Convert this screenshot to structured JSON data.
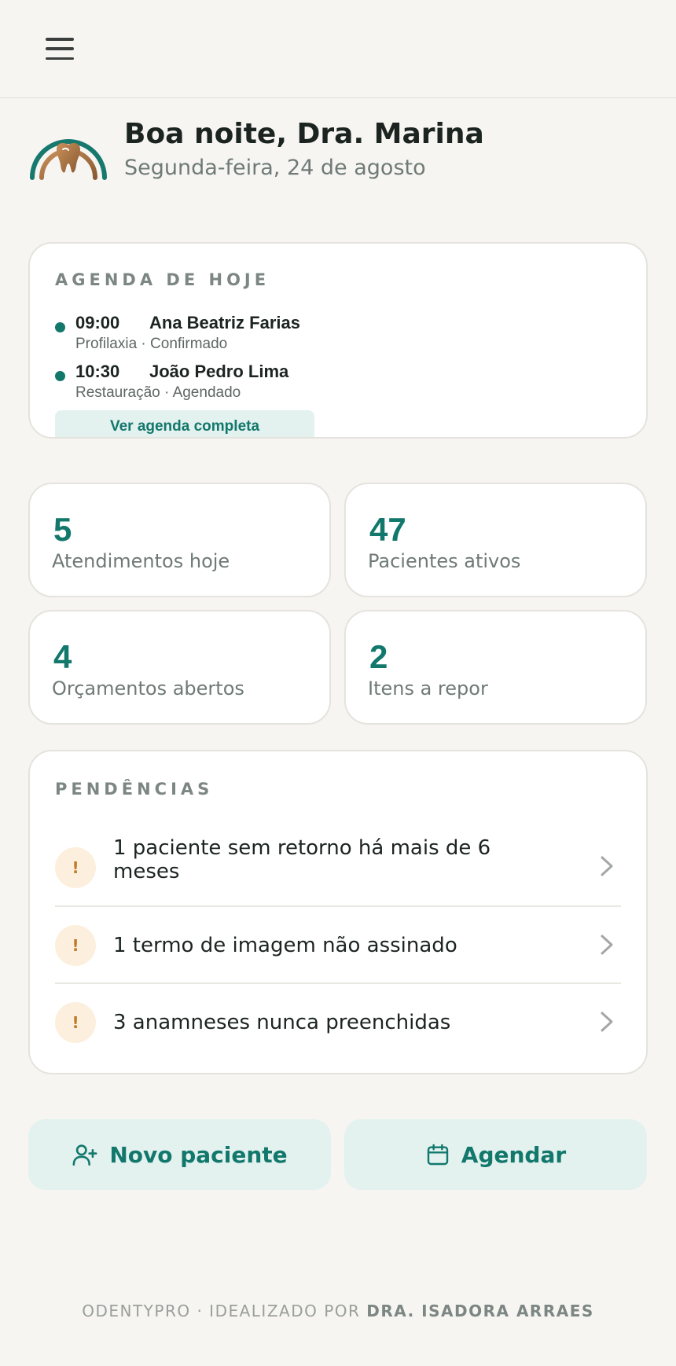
{
  "header": {
    "menu_icon": "hamburger-menu-icon"
  },
  "greeting": {
    "logo": "tooth-arch-logo",
    "title": "Boa noite, Dra. Marina",
    "date": "Segunda-feira, 24 de agosto"
  },
  "agenda": {
    "title": "AGENDA DE HOJE",
    "appointments": [
      {
        "time": "09:00",
        "patient": "Ana Beatriz Farias",
        "meta": "Profilaxia · Confirmado"
      },
      {
        "time": "10:30",
        "patient": "João Pedro Lima",
        "meta": "Restauração · Agendado"
      }
    ],
    "view_all_label": "Ver agenda completa"
  },
  "stats": [
    {
      "value": "5",
      "label": "Atendimentos hoje"
    },
    {
      "value": "47",
      "label": "Pacientes ativos"
    },
    {
      "value": "4",
      "label": "Orçamentos abertos"
    },
    {
      "value": "2",
      "label": "Itens a repor"
    }
  ],
  "pending": {
    "title": "PENDÊNCIAS",
    "items": [
      {
        "icon": "!",
        "text": "1 paciente sem retorno há mais de 6 meses"
      },
      {
        "icon": "!",
        "text": "1 termo de imagem não assinado"
      },
      {
        "icon": "!",
        "text": "3 anamneses nunca preenchidas"
      }
    ]
  },
  "actions": {
    "new_patient_label": "Novo paciente",
    "new_patient_icon": "user-plus-icon",
    "schedule_label": "Agendar",
    "schedule_icon": "calendar-icon"
  },
  "footer": {
    "prefix": "ODENTYPRO · IDEALIZADO POR",
    "author": "DRA. ISADORA ARRAES"
  },
  "colors": {
    "accent": "#12786c",
    "background": "#f6f5f2",
    "warning_bg": "#fcefdd",
    "warning_fg": "#c07a2a"
  }
}
